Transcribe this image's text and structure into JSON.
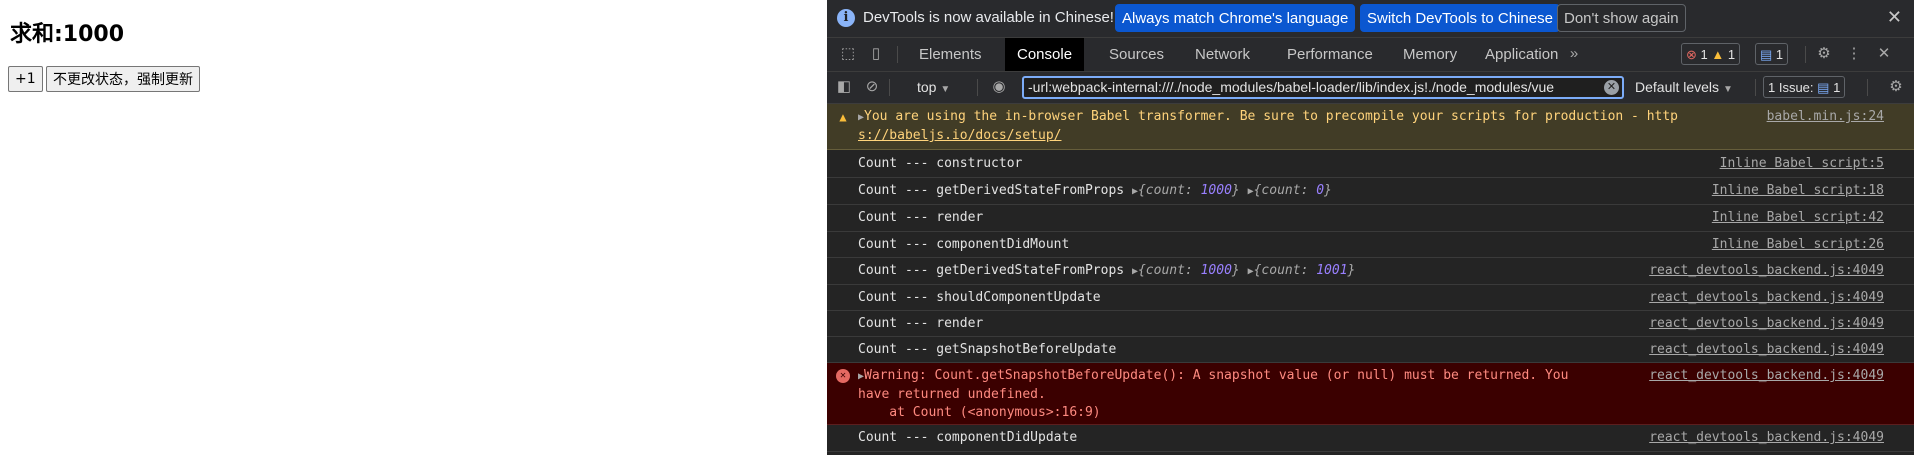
{
  "page": {
    "heading": "求和:1000",
    "btn_increment": "+1",
    "btn_force": "不更改状态，强制更新"
  },
  "devtools": {
    "infobar": {
      "text": "DevTools is now available in Chinese!",
      "btn_match": "Always match Chrome's language",
      "btn_switch": "Switch DevTools to Chinese",
      "btn_dismiss": "Don't show again"
    },
    "tabs": [
      "Elements",
      "Console",
      "Sources",
      "Network",
      "Performance",
      "Memory",
      "Application"
    ],
    "active_tab": "Console",
    "counts": {
      "errors": "1",
      "warnings": "1",
      "messages": "1"
    },
    "filter": {
      "context": "top",
      "value": "-url:webpack-internal:///./node_modules/babel-loader/lib/index.js!./node_modules/vue",
      "levels": "Default levels",
      "issues": "1 Issue:",
      "issues_count": "1"
    },
    "console": {
      "warning": {
        "line1": "You are using the in-browser Babel transformer. Be sure to precompile your scripts for production - http",
        "line2": "s://babeljs.io/docs/setup/",
        "source": "babel.min.js:24"
      },
      "logs": [
        {
          "text": "Count --- constructor",
          "source": "Inline Babel script:5"
        },
        {
          "text": "Count --- getDerivedStateFromProps",
          "source": "Inline Babel script:18",
          "obj1": {
            "key": "count",
            "val": "1000"
          },
          "obj2": {
            "key": "count",
            "val": "0"
          }
        },
        {
          "text": "Count --- render",
          "source": "Inline Babel script:42"
        },
        {
          "text": "Count --- componentDidMount",
          "source": "Inline Babel script:26"
        },
        {
          "text": "Count --- getDerivedStateFromProps",
          "source": "react_devtools_backend.js:4049",
          "obj1": {
            "key": "count",
            "val": "1000"
          },
          "obj2": {
            "key": "count",
            "val": "1001"
          }
        },
        {
          "text": "Count --- shouldComponentUpdate",
          "source": "react_devtools_backend.js:4049"
        },
        {
          "text": "Count --- render",
          "source": "react_devtools_backend.js:4049"
        },
        {
          "text": "Count --- getSnapshotBeforeUpdate",
          "source": "react_devtools_backend.js:4049"
        }
      ],
      "error": {
        "line1": "Warning: Count.getSnapshotBeforeUpdate(): A snapshot value (or null) must be returned. You",
        "line2": "have returned undefined.",
        "line3": "    at Count (<anonymous>:16:9)",
        "source": "react_devtools_backend.js:4049"
      },
      "last": {
        "text": "Count --- componentDidUpdate",
        "source": "react_devtools_backend.js:4049"
      }
    }
  },
  "colors": {
    "accent": "#0b57d0",
    "warning": "#ffd37b",
    "error": "#ff8a80",
    "object_value": "#9980ff"
  }
}
